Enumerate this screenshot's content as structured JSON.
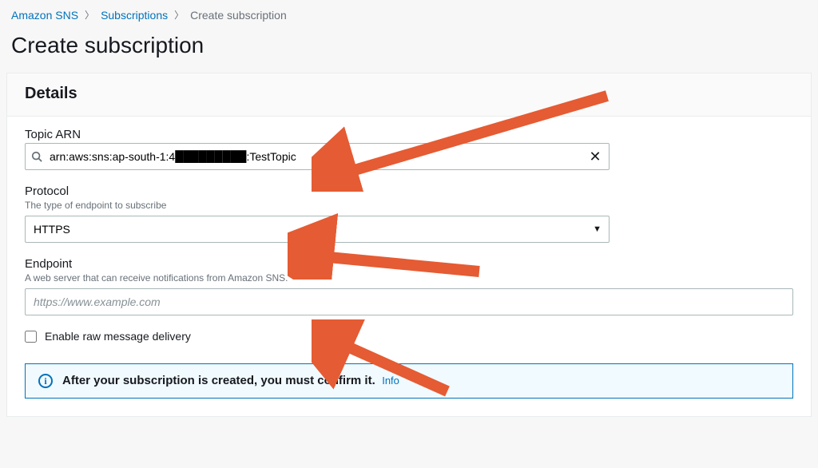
{
  "breadcrumb": {
    "root": "Amazon SNS",
    "second": "Subscriptions",
    "current": "Create subscription"
  },
  "page": {
    "title": "Create subscription"
  },
  "panel": {
    "title": "Details"
  },
  "topic_arn": {
    "label": "Topic ARN",
    "value": "arn:aws:sns:ap-south-1:4█████████:TestTopic"
  },
  "protocol": {
    "label": "Protocol",
    "help": "The type of endpoint to subscribe",
    "value": "HTTPS"
  },
  "endpoint": {
    "label": "Endpoint",
    "help": "A web server that can receive notifications from Amazon SNS.",
    "placeholder": "https://www.example.com"
  },
  "raw_delivery": {
    "label": "Enable raw message delivery"
  },
  "info_box": {
    "text": "After your subscription is created, you must confirm it.",
    "link_label": "Info"
  }
}
